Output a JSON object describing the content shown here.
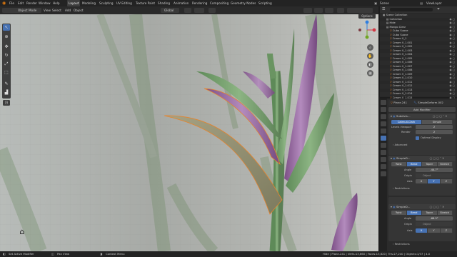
{
  "topbar": {
    "menus": [
      "File",
      "Edit",
      "Render",
      "Window",
      "Help"
    ],
    "workspaces": [
      "Layout",
      "Modeling",
      "Sculpting",
      "UV Editing",
      "Texture Paint",
      "Shading",
      "Animation",
      "Rendering",
      "Compositing",
      "Geometry Nodes",
      "Scripting"
    ],
    "active_workspace": "Layout",
    "scene_label": "Scene",
    "view_layer_label": "ViewLayer"
  },
  "viewport_header": {
    "mode": "Object Mode",
    "menus": [
      "View",
      "Select",
      "Add",
      "Object"
    ],
    "transform_orientation": "Global",
    "options_label": "Options"
  },
  "outliner": {
    "title": "Scene Collection",
    "rows": [
      {
        "label": "Collection",
        "indent": 1
      },
      {
        "label": "Hide",
        "indent": 1
      },
      {
        "label": "Mongo Clear",
        "indent": 1
      },
      {
        "label": "Cubo Suave",
        "indent": 2
      },
      {
        "label": "Cubo Suave",
        "indent": 2
      },
      {
        "label": "Cream V_1",
        "indent": 2
      },
      {
        "label": "Cream V_1.001",
        "indent": 2
      },
      {
        "label": "Cream V_1.002",
        "indent": 2
      },
      {
        "label": "Cream V_1.003",
        "indent": 2
      },
      {
        "label": "Cream V_1.004",
        "indent": 2
      },
      {
        "label": "Cream V_1.005",
        "indent": 2
      },
      {
        "label": "Cream V_1.006",
        "indent": 2
      },
      {
        "label": "Cream V_1.007",
        "indent": 2
      },
      {
        "label": "Cream V_1.008",
        "indent": 2
      },
      {
        "label": "Cream V_1.009",
        "indent": 2
      },
      {
        "label": "Cream V_1.010",
        "indent": 2
      },
      {
        "label": "Cream V_1.011",
        "indent": 2
      },
      {
        "label": "Cream V_1.012",
        "indent": 2
      },
      {
        "label": "Cream V_1.013",
        "indent": 2
      },
      {
        "label": "Cream V_1.014",
        "indent": 2
      },
      {
        "label": "Cream V_1.015",
        "indent": 2
      }
    ]
  },
  "properties": {
    "object_name": "Plane.241",
    "modifier_name": "SimpleDeform.002",
    "add_modifier_label": "Add Modifier",
    "subdivision": {
      "name": "Subdivis...",
      "modes": [
        "Catmull-Clark",
        "Simple"
      ],
      "active_mode": "Catmull-Clark",
      "levels_viewport_label": "Levels Viewport",
      "levels_viewport_value": "2",
      "render_label": "Render",
      "render_value": "2",
      "optimal_display_label": "Optimal Display",
      "advanced_label": "Advanced"
    },
    "deforms": [
      {
        "name": "SimpleD...",
        "modes": [
          "Twist",
          "Bend",
          "Taper",
          "Stretch"
        ],
        "active_mode": "Bend",
        "angle_label": "Angle",
        "angle_value": "-44.7°",
        "origin_label": "Origin",
        "origin_value": "Object",
        "axis_label": "Axis",
        "axes": [
          "X",
          "Y",
          "Z"
        ],
        "active_axis": "Y",
        "restrictions_label": "Restrictions"
      },
      {
        "name": "SimpleD...",
        "modes": [
          "Twist",
          "Bend",
          "Taper",
          "Stretch"
        ],
        "active_mode": "Bend",
        "angle_label": "Angle",
        "angle_value": "-68.5°",
        "origin_label": "Origin",
        "origin_value": "Object",
        "axis_label": "Axis",
        "axes": [
          "X",
          "Y",
          "Z"
        ],
        "active_axis": "X",
        "restrictions_label": "Restrictions"
      }
    ]
  },
  "statusbar": {
    "left": [
      "Set Active Modifier",
      "Pan View",
      "Context Menu"
    ],
    "right": "Hide | Plane.241 | Verts:13,660 | Faces:13,620 | Tris:27,240 | Objects:1/37 | 4.0"
  },
  "colors": {
    "accent": "#4772b3",
    "leaf_green": "#7da375",
    "leaf_purple": "#9a6fa3",
    "leaf_olive": "#9b9b7a",
    "selection_outline": "#e8832b"
  }
}
